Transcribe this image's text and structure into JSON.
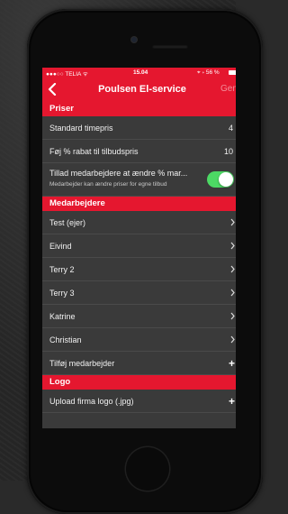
{
  "status_bar": {
    "carrier": "●●●○○ TELIA ᯤ",
    "time": "15.04",
    "battery": "56 %"
  },
  "nav": {
    "title": "Poulsen El-service",
    "action": "Gem"
  },
  "sections": {
    "priser": {
      "header": "Priser",
      "standard_label": "Standard timepris",
      "standard_value": "4",
      "rabat_label": "Føj % rabat til tilbudspris",
      "rabat_value": "10",
      "toggle_label": "Tillad medarbejdere at ændre % mar...",
      "toggle_sublabel": "Medarbejder kan ændre priser for egne tilbud",
      "toggle_on": true
    },
    "medarbejdere": {
      "header": "Medarbejdere",
      "items": [
        "Test (ejer)",
        "Eivind",
        "Terry 2",
        "Terry 3",
        "Katrine",
        "Christian"
      ],
      "add_label": "Tilføj medarbejder"
    },
    "logo": {
      "header": "Logo",
      "upload_label": "Upload firma logo (.jpg)"
    }
  },
  "colors": {
    "accent": "#e5172f",
    "toggle_on": "#4cd964",
    "background": "#3a3a3a"
  }
}
